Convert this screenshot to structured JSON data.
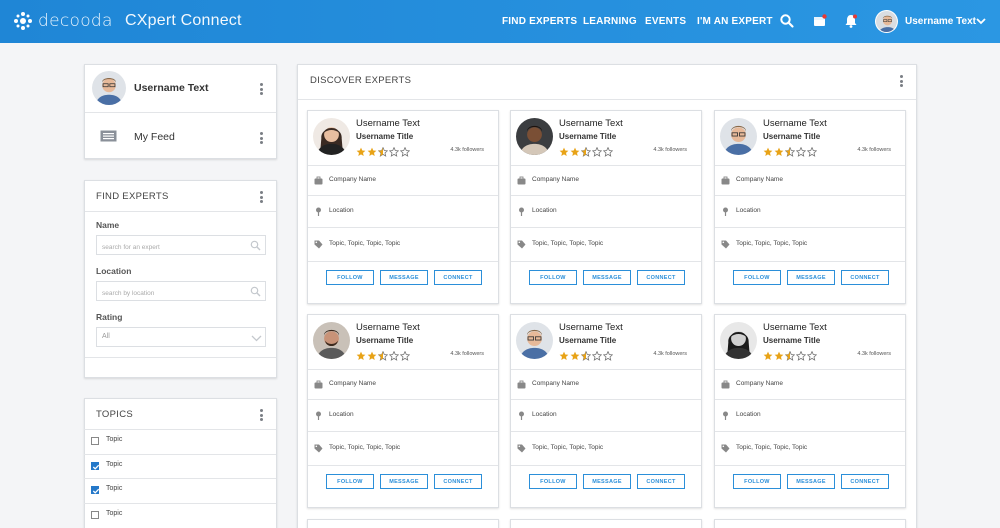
{
  "header": {
    "logo_text": "decooda",
    "app_title": "CXpert Connect",
    "nav": [
      "FIND EXPERTS",
      "LEARNING",
      "EVENTS",
      "I'M AN EXPERT"
    ],
    "icons": [
      "search-icon",
      "calendar-icon",
      "bell-icon"
    ],
    "username": "Username Text",
    "accent": "#2b97e3"
  },
  "profile_panel": {
    "username": "Username Text",
    "feed_label": "My Feed"
  },
  "find_experts": {
    "title": "FIND EXPERTS",
    "name_label": "Name",
    "name_placeholder": "search for an expert",
    "location_label": "Location",
    "location_placeholder": "search by location",
    "rating_label": "Rating",
    "rating_value": "All"
  },
  "topics": {
    "title": "TOPICS",
    "items": [
      {
        "label": "Topic",
        "checked": false
      },
      {
        "label": "Topic",
        "checked": true
      },
      {
        "label": "Topic",
        "checked": true
      },
      {
        "label": "Topic",
        "checked": false
      }
    ]
  },
  "discover": {
    "title": "DISCOVER EXPERTS",
    "buttons": {
      "follow": "FOLLOW",
      "message": "MESSAGE",
      "connect": "CONNECT"
    },
    "experts": [
      {
        "name": "Username Text",
        "title": "Username Title",
        "rating": 2.5,
        "followers": "4.3k followers",
        "company": "Company Name",
        "location": "Location",
        "topics": "Topic, Topic, Topic, Topic",
        "avatar": "woman-dark-hair"
      },
      {
        "name": "Username Text",
        "title": "Username Title",
        "rating": 2.5,
        "followers": "4.3k followers",
        "company": "Company Name",
        "location": "Location",
        "topics": "Topic, Topic, Topic, Topic",
        "avatar": "woman-dark-skin"
      },
      {
        "name": "Username Text",
        "title": "Username Title",
        "rating": 2.5,
        "followers": "4.3k followers",
        "company": "Company Name",
        "location": "Location",
        "topics": "Topic, Topic, Topic, Topic",
        "avatar": "man-glasses"
      },
      {
        "name": "Username Text",
        "title": "Username Title",
        "rating": 2.5,
        "followers": "4.3k followers",
        "company": "Company Name",
        "location": "Location",
        "topics": "Topic, Topic, Topic, Topic",
        "avatar": "man-beard"
      },
      {
        "name": "Username Text",
        "title": "Username Title",
        "rating": 2.5,
        "followers": "4.3k followers",
        "company": "Company Name",
        "location": "Location",
        "topics": "Topic, Topic, Topic, Topic",
        "avatar": "man-glasses"
      },
      {
        "name": "Username Text",
        "title": "Username Title",
        "rating": 2.5,
        "followers": "4.3k followers",
        "company": "Company Name",
        "location": "Location",
        "topics": "Topic, Topic, Topic, Topic",
        "avatar": "woman-bw"
      }
    ]
  }
}
